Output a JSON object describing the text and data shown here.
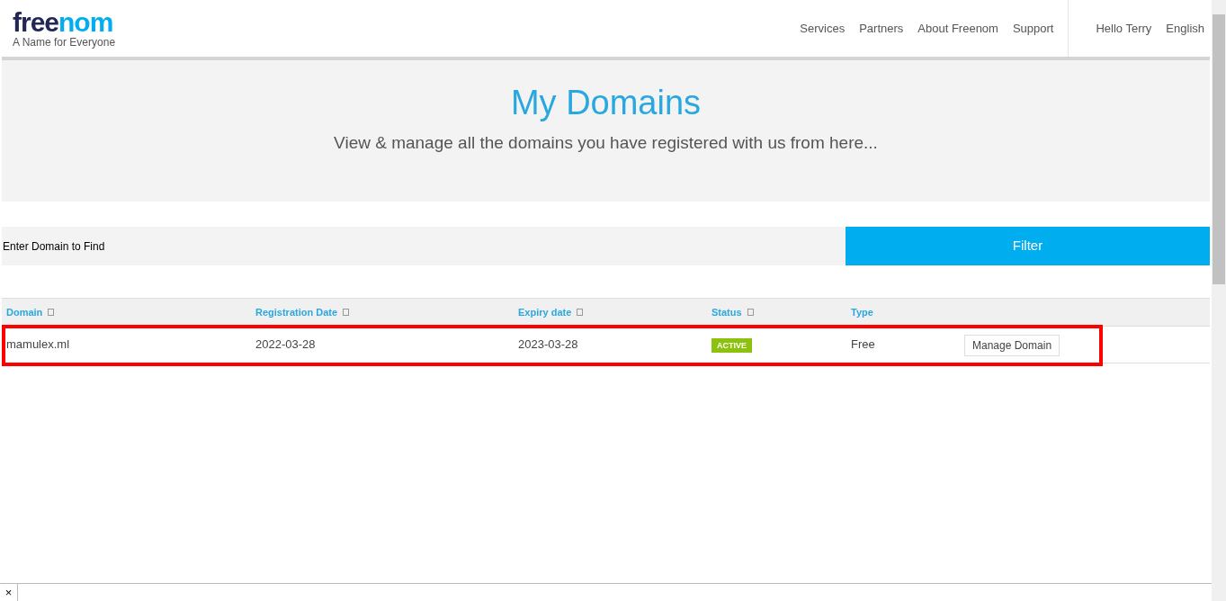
{
  "logo": {
    "part_1": "free",
    "part_2": "nom",
    "tagline": "A Name for Everyone"
  },
  "nav": {
    "links": [
      "Services",
      "Partners",
      "About Freenom",
      "Support"
    ],
    "user": "Hello Terry",
    "language": "English"
  },
  "hero": {
    "title": "My Domains",
    "subtitle": "View & manage all the domains you have registered with us from here..."
  },
  "search": {
    "placeholder": "Enter Domain to Find",
    "button": "Filter"
  },
  "table": {
    "columns": [
      {
        "label": "Domain",
        "sortable": true
      },
      {
        "label": "Registration Date",
        "sortable": true
      },
      {
        "label": "Expiry date",
        "sortable": true
      },
      {
        "label": "Status",
        "sortable": true
      },
      {
        "label": "Type",
        "sortable": false
      }
    ],
    "rows": [
      {
        "domain": "mamulex.ml",
        "registration_date": "2022-03-28",
        "expiry_date": "2023-03-28",
        "status": "ACTIVE",
        "type": "Free",
        "action": "Manage Domain",
        "highlighted": true
      }
    ]
  },
  "bottom_bar": {
    "close": "×"
  }
}
